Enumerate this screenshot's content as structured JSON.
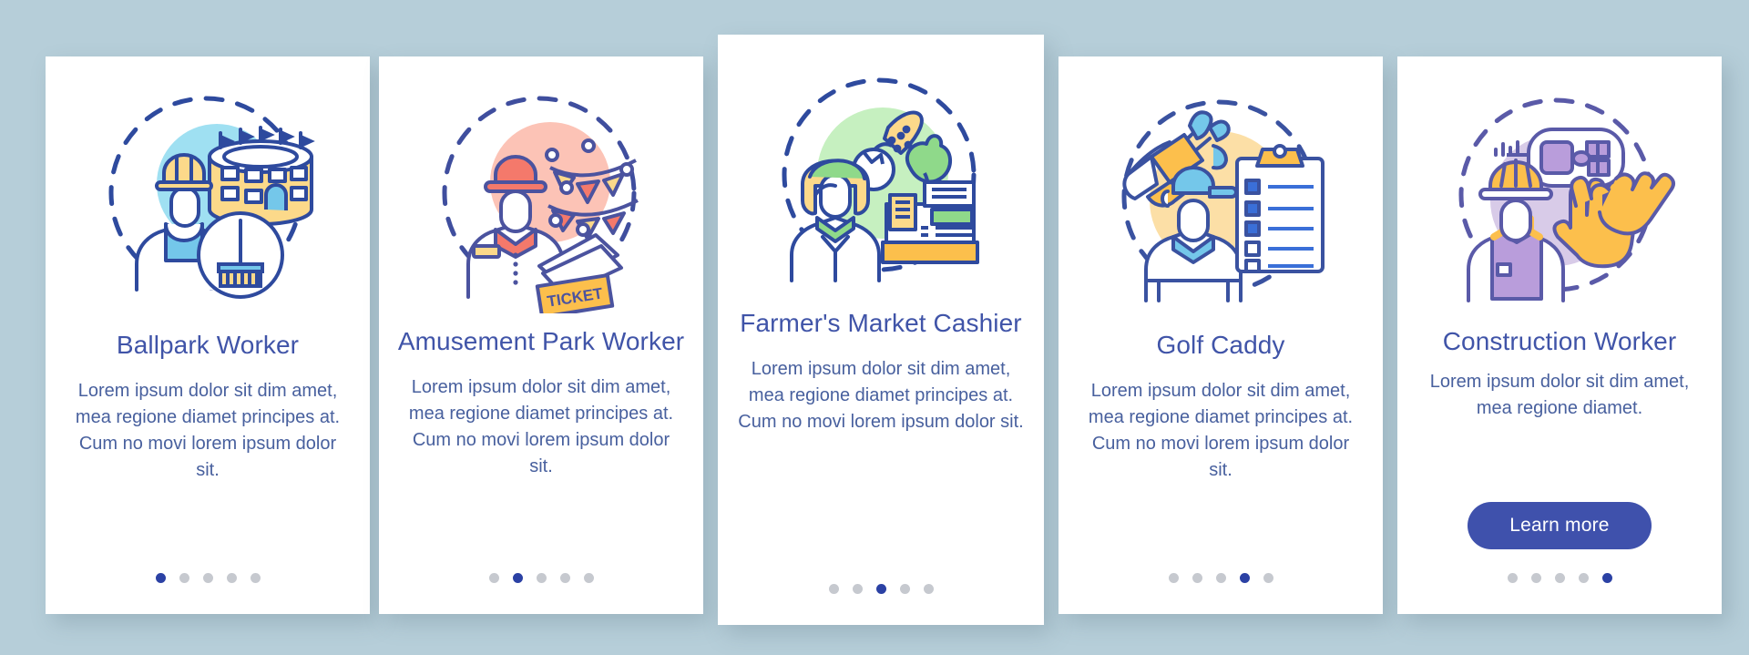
{
  "page": {
    "background_color": "#b6ced9",
    "title_color": "#4054a8",
    "body_color": "#48609e",
    "accent_color": "#3f51ac",
    "dot_active_color": "#2b41a4",
    "dot_inactive_color": "#c6c9cf",
    "card_background": "#ffffff"
  },
  "cards": [
    {
      "id": "ballpark-worker",
      "title": "Ballpark Worker",
      "body": "Lorem ipsum dolor sit dim amet, mea regione diamet principes at. Cum no movi lorem ipsum dolor sit.",
      "illustration": "ballpark-worker-illustration",
      "illustration_blob_color": "#9fe0f2",
      "dots": {
        "count": 5,
        "active_index": 0
      },
      "has_button": false
    },
    {
      "id": "amusement-park-worker",
      "title": "Amusement Park Worker",
      "body": "Lorem ipsum dolor sit dim amet, mea regione diamet principes at. Cum no movi lorem ipsum dolor sit.",
      "illustration": "amusement-park-worker-illustration",
      "illustration_blob_color": "#fcc3b6",
      "illustration_label": "TICKET",
      "dots": {
        "count": 5,
        "active_index": 1
      },
      "has_button": false
    },
    {
      "id": "farmers-market-cashier",
      "title": "Farmer's Market Cashier",
      "body": "Lorem ipsum dolor sit dim amet, mea regione diamet principes at. Cum no movi lorem ipsum dolor sit.",
      "illustration": "farmers-market-cashier-illustration",
      "illustration_blob_color": "#c6f0c0",
      "dots": {
        "count": 5,
        "active_index": 2
      },
      "has_button": false
    },
    {
      "id": "golf-caddy",
      "title": "Golf Caddy",
      "body": "Lorem ipsum dolor sit dim amet, mea regione diamet principes at. Cum no movi lorem ipsum dolor sit.",
      "illustration": "golf-caddy-illustration",
      "illustration_blob_color": "#fcdfa6",
      "dots": {
        "count": 5,
        "active_index": 3
      },
      "has_button": false
    },
    {
      "id": "construction-worker",
      "title": "Construction Worker",
      "body": "Lorem ipsum dolor sit dim amet, mea regione diamet.",
      "illustration": "construction-worker-illustration",
      "illustration_blob_color": "#d8cbe8",
      "button_label": "Learn more",
      "dots": {
        "count": 5,
        "active_index": 4
      },
      "has_button": true
    }
  ]
}
